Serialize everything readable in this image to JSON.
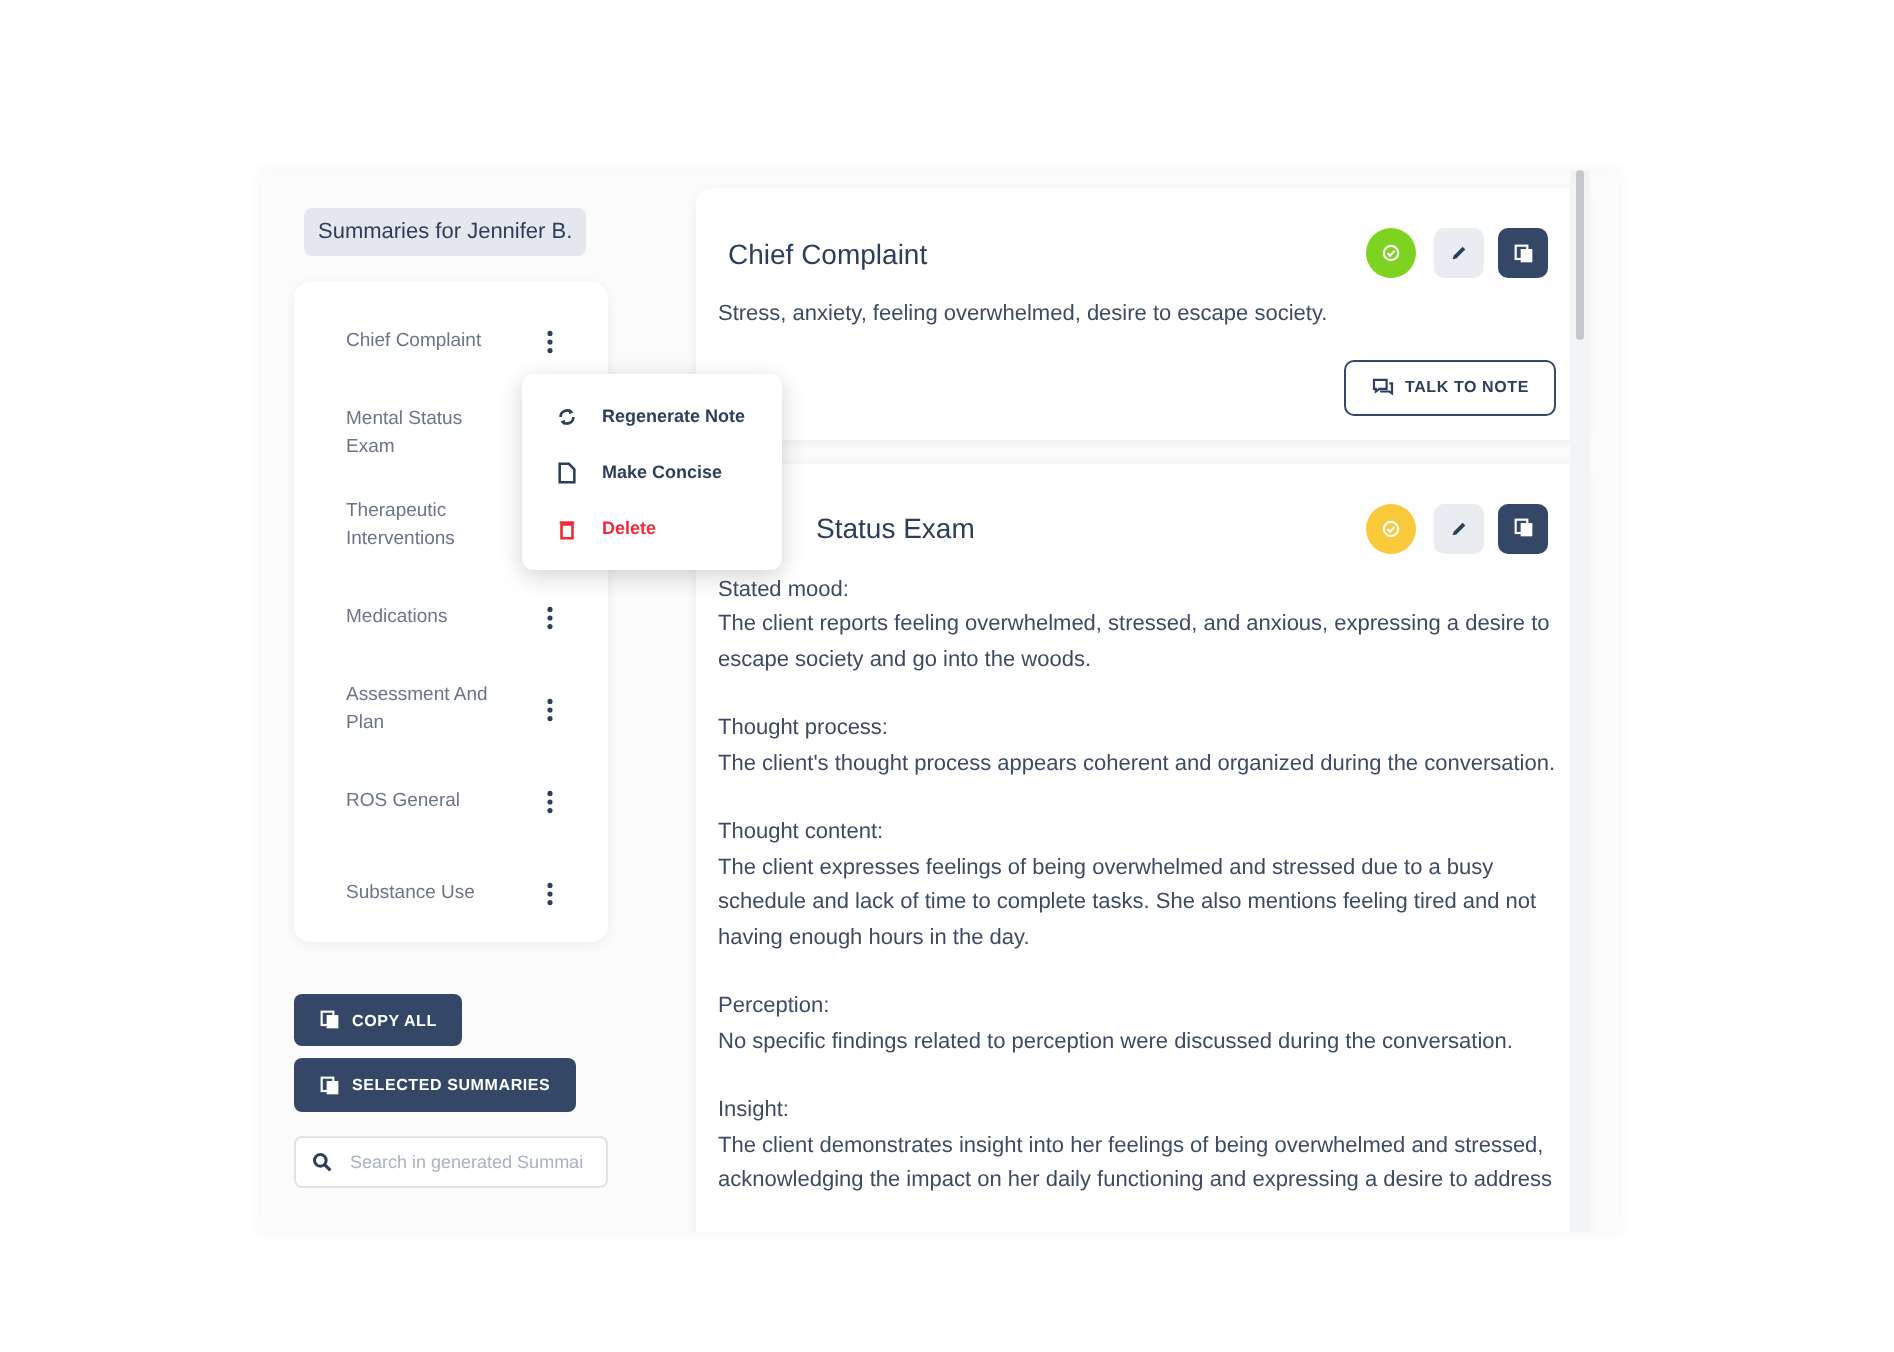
{
  "sidebar": {
    "header": "Summaries for Jennifer B.",
    "items": [
      {
        "label": "Chief Complaint"
      },
      {
        "label": "Mental Status Exam"
      },
      {
        "label": "Therapeutic Interventions"
      },
      {
        "label": "Medications"
      },
      {
        "label": "Assessment And Plan"
      },
      {
        "label": "ROS General"
      },
      {
        "label": "Substance Use"
      }
    ],
    "buttons": [
      "COPY ALL",
      "SELECTED SUMMARIES"
    ],
    "search": {
      "placeholder": "Search in generated Summai"
    }
  },
  "context_menu": [
    {
      "label": "Regenerate Note",
      "kind": "regenerate"
    },
    {
      "label": "Make Concise",
      "kind": "concise"
    },
    {
      "label": "Delete",
      "kind": "delete"
    }
  ],
  "cards": [
    {
      "title": "Chief Complaint",
      "color": "#7ed321",
      "sections": [
        {
          "text": "Stress, anxiety, feeling overwhelmed, desire to escape society."
        }
      ],
      "action": "TALK TO NOTE"
    },
    {
      "title": "Status Exam",
      "color": "#f8c93a",
      "sections": [
        {
          "label": "Stated mood:",
          "text": "The client reports feeling overwhelmed, stressed, and anxious, expressing a desire to escape society and go into the woods."
        },
        {
          "label": "Thought process:",
          "text": "The client's thought process appears coherent and organized during the conversation."
        },
        {
          "label": "Thought content:",
          "text": "The client expresses feelings of being overwhelmed and stressed due to a busy schedule and lack of time to complete tasks. She also mentions feeling tired and not having enough hours in the day."
        },
        {
          "label": "Perception:",
          "text": "No specific findings related to perception were discussed during the conversation."
        },
        {
          "label": "Insight:",
          "text": "The client demonstrates insight into her feelings of being overwhelmed and stressed, acknowledging the impact on her daily functioning and expressing a desire to address"
        }
      ]
    }
  ]
}
